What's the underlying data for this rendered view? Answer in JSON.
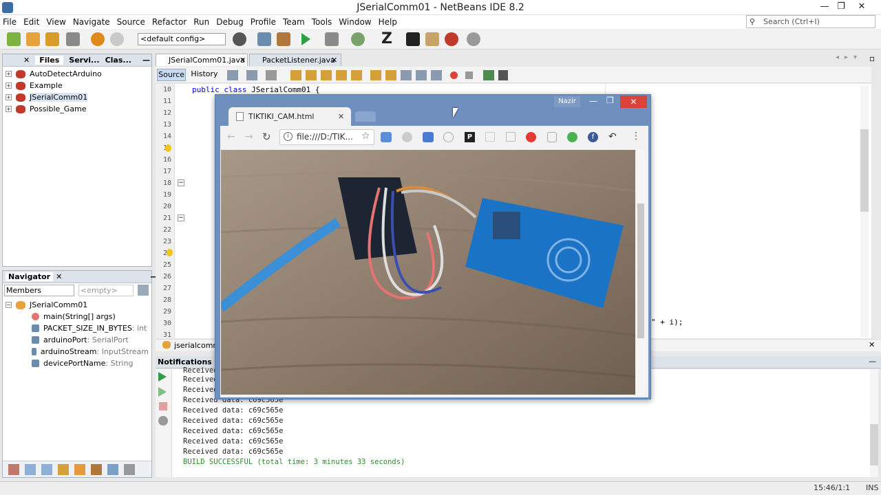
{
  "window": {
    "title": "JSerialComm01 - NetBeans IDE 8.2",
    "minimize": "—",
    "maximize": "❐",
    "close": "✕"
  },
  "menu": [
    "File",
    "Edit",
    "View",
    "Navigate",
    "Source",
    "Refactor",
    "Run",
    "Debug",
    "Profile",
    "Team",
    "Tools",
    "Window",
    "Help"
  ],
  "search": {
    "placeholder": "Search (Ctrl+I)"
  },
  "toolbar": {
    "config": "<default config>"
  },
  "projects_panel": {
    "tabs": [
      "Files",
      "Servi...",
      "Clas..."
    ],
    "projects": [
      "AutoDetectArduino",
      "Example",
      "JSerialComm01",
      "Possible_Game"
    ]
  },
  "navigator": {
    "title": "Navigator",
    "filter": "Members",
    "empty": "<empty>",
    "root": "JSerialComm01",
    "members": [
      {
        "name": "main(String[] args)",
        "type": ""
      },
      {
        "name": "PACKET_SIZE_IN_BYTES",
        "type": " : int"
      },
      {
        "name": "arduinoPort",
        "type": " : SerialPort"
      },
      {
        "name": "arduinoStream",
        "type": " : InputStream"
      },
      {
        "name": "devicePortName",
        "type": " : String"
      }
    ]
  },
  "editor": {
    "tabs": [
      "JSerialComm01.java",
      "PacketListener.java"
    ],
    "source_tab": "Source",
    "history_tab": "History",
    "line_numbers": [
      "10",
      "11",
      "12",
      "13",
      "14",
      "15",
      "16",
      "17",
      "18",
      "19",
      "20",
      "21",
      "22",
      "23",
      "24",
      "25",
      "26",
      "27",
      "28",
      "29",
      "30",
      "31"
    ],
    "code_line_10_kw": "public class",
    "code_line_10_rest": " JSerialComm01 {",
    "code_line_30_tail": "\" + i);",
    "breadcrumb": "jserialcomm0"
  },
  "output": {
    "title": "Notifications",
    "lines": [
      "Received",
      "Received",
      "Received",
      "Received data: c69c565e",
      "Received data: c69c565e",
      "Received data: c69c565e",
      "Received data: c69c565e",
      "Received data: c69c565e",
      "Received data: c69c565e"
    ],
    "build": "BUILD SUCCESSFUL (total time: 3 minutes 33 seconds)"
  },
  "browser": {
    "user": "Nazir",
    "tab_title": "TIKTIKI_CAM.html",
    "url": "file:///D:/TIK..."
  },
  "status": {
    "position": "15:46/1:1",
    "mode": "INS"
  },
  "colors": {
    "nb_blue": "#3a6ea5",
    "browser_frame": "#6f8fbf",
    "build_green": "#2e8b2e",
    "close_red": "#d9433a"
  }
}
